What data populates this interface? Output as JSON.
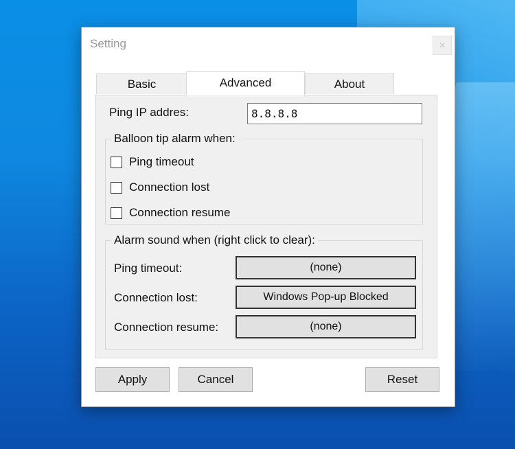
{
  "window": {
    "title": "Setting",
    "close_label": "✕"
  },
  "tabs": [
    {
      "label": "Basic",
      "active": false
    },
    {
      "label": "Advanced",
      "active": true
    },
    {
      "label": "About",
      "active": false
    }
  ],
  "advanced": {
    "ping_ip_label": "Ping IP addres:",
    "ping_ip_value": "8.8.8.8",
    "balloon_group": {
      "title": "Balloon tip alarm when:",
      "options": [
        {
          "label": "Ping timeout",
          "checked": false
        },
        {
          "label": "Connection lost",
          "checked": false
        },
        {
          "label": "Connection resume",
          "checked": false
        }
      ]
    },
    "sound_group": {
      "title": "Alarm sound when (right click to clear):",
      "rows": [
        {
          "label": "Ping timeout:",
          "value": "(none)"
        },
        {
          "label": "Connection lost:",
          "value": "Windows Pop-up Blocked"
        },
        {
          "label": "Connection resume:",
          "value": "(none)"
        }
      ]
    }
  },
  "footer": {
    "apply": "Apply",
    "cancel": "Cancel",
    "reset": "Reset"
  },
  "colors": {
    "desktop": "#0f88e0",
    "dialog_bg": "#ffffff",
    "panel_bg": "#f0f0f0",
    "button_bg": "#e1e1e1"
  }
}
